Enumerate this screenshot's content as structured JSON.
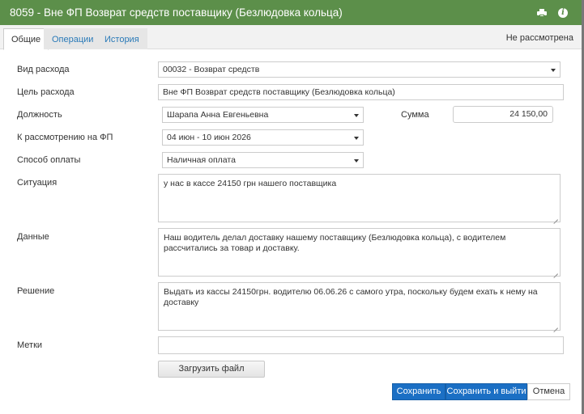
{
  "window": {
    "title": "8059 - Вне ФП Возврат средств поставщику (Безлюдовка кольца)",
    "icons": [
      "printer-icon",
      "info-icon"
    ],
    "accent_color": "#5c8f4a"
  },
  "tabs": [
    {
      "label": "Общие",
      "active": true
    },
    {
      "label": "Операции",
      "active": false
    },
    {
      "label": "История",
      "active": false
    }
  ],
  "status": "Не рассмотрена",
  "form": {
    "expense_type": {
      "label": "Вид расхода",
      "value": "00032 - Возврат средств"
    },
    "expense_purpose": {
      "label": "Цель расхода",
      "value": "Вне ФП Возврат средств поставщику (Безлюдовка кольца)"
    },
    "position": {
      "label": "Должность",
      "value": "Шарапа Анна Евгеньевна"
    },
    "amount": {
      "label": "Сумма",
      "value": "24 150,00"
    },
    "review_period": {
      "label": "К рассмотрению на ФП",
      "value": "04 июн - 10 июн 2026"
    },
    "payment_method": {
      "label": "Способ оплаты",
      "value": "Наличная оплата"
    },
    "situation": {
      "label": "Ситуация",
      "value": "у нас в кассе 24150 грн нашего поставщика"
    },
    "data": {
      "label": "Данные",
      "value": "Наш водитель делал доставку нашему поставщику (Безлюдовка кольца), с водителем рассчитались за товар и доставку."
    },
    "decision": {
      "label": "Решение",
      "value": "Выдать из кассы 24150грн. водителю 06.06.26 с самого утра, поскольку будем ехать к нему на доставку"
    },
    "tags": {
      "label": "Метки",
      "value": ""
    }
  },
  "buttons": {
    "upload": "Загрузить файл",
    "save": "Сохранить",
    "save_exit": "Сохранить и выйти",
    "cancel": "Отмена"
  }
}
